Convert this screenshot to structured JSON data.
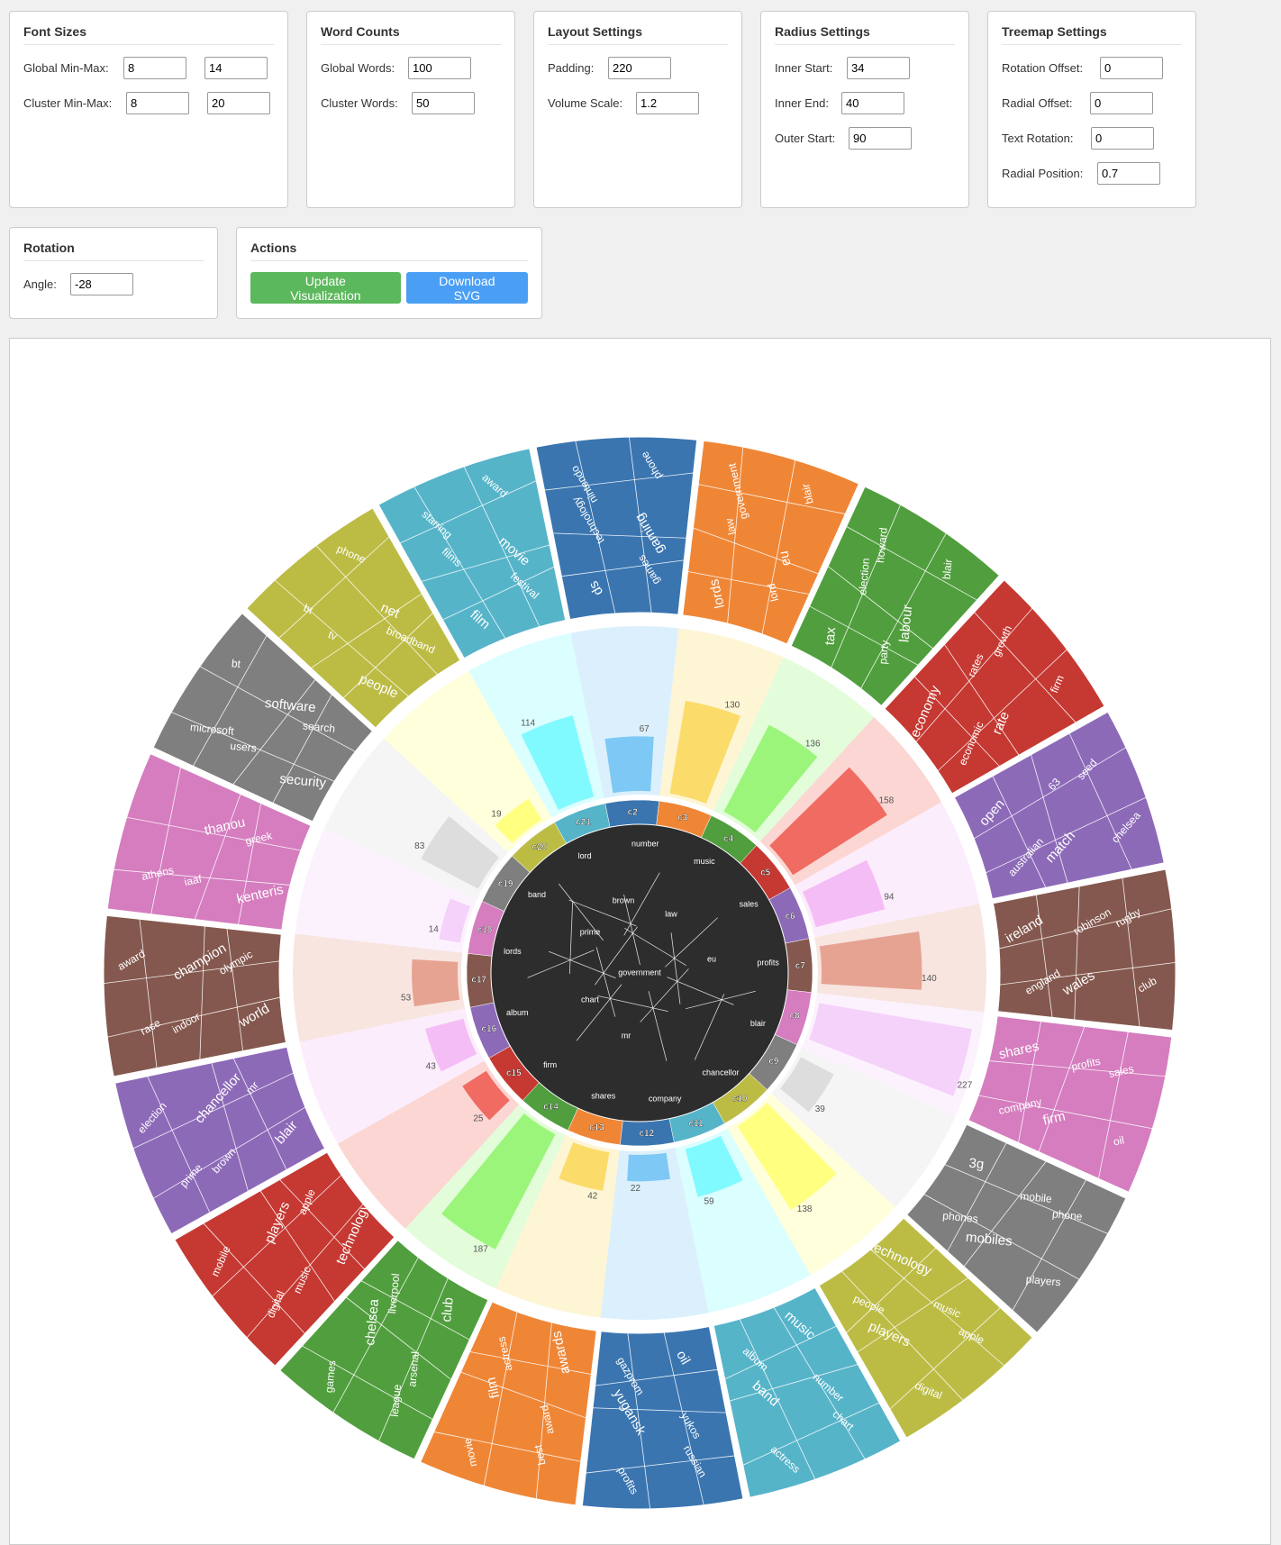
{
  "font_sizes": {
    "title": "Font Sizes",
    "global_label": "Global Min-Max:",
    "global_min": "8",
    "global_max": "14",
    "cluster_label": "Cluster Min-Max:",
    "cluster_min": "8",
    "cluster_max": "20"
  },
  "word_counts": {
    "title": "Word Counts",
    "global_label": "Global Words:",
    "global_value": "100",
    "cluster_label": "Cluster Words:",
    "cluster_value": "50"
  },
  "layout": {
    "title": "Layout Settings",
    "padding_label": "Padding:",
    "padding_value": "220",
    "volume_label": "Volume Scale:",
    "volume_value": "1.2"
  },
  "radius": {
    "title": "Radius Settings",
    "inner_start_label": "Inner Start:",
    "inner_start_value": "34",
    "inner_end_label": "Inner End:",
    "inner_end_value": "40",
    "outer_start_label": "Outer Start:",
    "outer_start_value": "90"
  },
  "treemap": {
    "title": "Treemap Settings",
    "rotation_offset_label": "Rotation Offset:",
    "rotation_offset_value": "0",
    "radial_offset_label": "Radial Offset:",
    "radial_offset_value": "0",
    "text_rotation_label": "Text Rotation:",
    "text_rotation_value": "0",
    "radial_position_label": "Radial Position:",
    "radial_position_value": "0.7"
  },
  "rotation": {
    "title": "Rotation",
    "angle_label": "Angle:",
    "angle_value": "-28"
  },
  "actions": {
    "title": "Actions",
    "update_label": "Update Visualization",
    "download_label": "Download SVG"
  },
  "chart_data": {
    "type": "radial-voronoi-treemap",
    "clusters": [
      {
        "id": "c2",
        "count": 67,
        "color": "#3a75b0",
        "bar": "#7ec8f5",
        "words": [
          "ds",
          "gaming",
          "nintendo",
          "games",
          "technology",
          "phone"
        ]
      },
      {
        "id": "c3",
        "count": 130,
        "color": "#ef8636",
        "bar": "#fbdc6a",
        "words": [
          "lords",
          "eu",
          "government",
          "lord",
          "law",
          "blair"
        ]
      },
      {
        "id": "c4",
        "count": 136,
        "color": "#519e3e",
        "bar": "#9bf57a",
        "words": [
          "tax",
          "labour",
          "howard",
          "party",
          "election",
          "blair"
        ]
      },
      {
        "id": "c5",
        "count": 158,
        "color": "#c53932",
        "bar": "#f06b62",
        "words": [
          "economy",
          "rate",
          "growth",
          "economic",
          "rates",
          "firm"
        ]
      },
      {
        "id": "c6",
        "count": 94,
        "color": "#8d6ab8",
        "bar": "#f5bdf5",
        "words": [
          "open",
          "match",
          "seed",
          "australian",
          "63",
          "chelsea"
        ]
      },
      {
        "id": "c7",
        "count": 140,
        "color": "#84584e",
        "bar": "#e6a392",
        "words": [
          "ireland",
          "wales",
          "rugby",
          "england",
          "robinson",
          "club"
        ]
      },
      {
        "id": "c8",
        "count": 227,
        "color": "#d57dbf",
        "bar": "#f5d2fa",
        "words": [
          "shares",
          "firm",
          "sales",
          "company",
          "profits",
          "oil"
        ]
      },
      {
        "id": "c9",
        "count": 39,
        "color": "#7f7f7f",
        "bar": "#dddddd",
        "words": [
          "3g",
          "mobiles",
          "phone",
          "phones",
          "mobile",
          "players"
        ]
      },
      {
        "id": "c10",
        "count": 138,
        "color": "#bcbc45",
        "bar": "#ffff80",
        "words": [
          "technology",
          "players",
          "apple",
          "people",
          "music",
          "digital"
        ]
      },
      {
        "id": "c11",
        "count": 59,
        "color": "#56b4c9",
        "bar": "#80faff",
        "words": [
          "music",
          "band",
          "chart",
          "album",
          "number",
          "actress"
        ]
      },
      {
        "id": "c12",
        "count": 22,
        "color": "#3a75b0",
        "bar": "#7ec8f5",
        "words": [
          "oil",
          "yugansk",
          "russian",
          "gazprom",
          "yukos",
          "profits"
        ]
      },
      {
        "id": "c13",
        "count": 42,
        "color": "#ef8636",
        "bar": "#fbdc6a",
        "words": [
          "awards",
          "film",
          "best",
          "actress",
          "award",
          "movie"
        ]
      },
      {
        "id": "c14",
        "count": 187,
        "color": "#519e3e",
        "bar": "#9bf57a",
        "words": [
          "club",
          "chelsea",
          "league",
          "liverpool",
          "arsenal",
          "games"
        ]
      },
      {
        "id": "c15",
        "count": 25,
        "color": "#c53932",
        "bar": "#f06b62",
        "words": [
          "technology",
          "players",
          "digital",
          "apple",
          "music",
          "mobile"
        ]
      },
      {
        "id": "c16",
        "count": 43,
        "color": "#8d6ab8",
        "bar": "#f5bdf5",
        "words": [
          "blair",
          "chancellor",
          "prime",
          "mr",
          "brown",
          "election"
        ]
      },
      {
        "id": "c17",
        "count": 53,
        "color": "#84584e",
        "bar": "#e6a392",
        "words": [
          "world",
          "champion",
          "race",
          "olympic",
          "indoor",
          "award"
        ]
      },
      {
        "id": "c18",
        "count": 14,
        "color": "#d57dbf",
        "bar": "#f5d2fa",
        "words": [
          "kenteris",
          "thanou",
          "athens",
          "greek",
          "iaaf"
        ]
      },
      {
        "id": "c19",
        "count": 83,
        "color": "#7f7f7f",
        "bar": "#dddddd",
        "words": [
          "security",
          "software",
          "microsoft",
          "search",
          "users",
          "bt"
        ]
      },
      {
        "id": "c20",
        "count": 19,
        "color": "#bcbc45",
        "bar": "#ffff80",
        "words": [
          "people",
          "net",
          "bt",
          "broadband",
          "tv",
          "phone"
        ]
      },
      {
        "id": "c21",
        "count": 114,
        "color": "#56b4c9",
        "bar": "#80faff",
        "words": [
          "film",
          "movie",
          "starring",
          "festival",
          "films",
          "award"
        ]
      }
    ],
    "center_words": [
      "number",
      "music",
      "sales",
      "profits",
      "blair",
      "chancellor",
      "company",
      "shares",
      "firm",
      "album",
      "lords",
      "band",
      "lord",
      "brown",
      "law",
      "prime",
      "eu",
      "government",
      "chart",
      "mr"
    ]
  }
}
